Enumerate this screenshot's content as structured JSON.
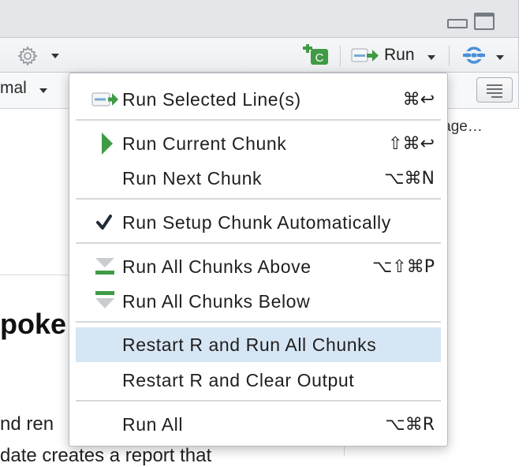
{
  "toolbar": {
    "run_label": "Run",
    "insert_chunk_letter": "C"
  },
  "format_menu": {
    "label": "mal"
  },
  "background_doc": {
    "language_fragment": "guage…",
    "heading_fragment": "poke",
    "paragraph_line1": "nd ren",
    "paragraph_line2": "date creates a report that"
  },
  "run_menu": {
    "items": [
      {
        "label": "Run Selected Line(s)",
        "shortcut": "⌘↩",
        "icon": "run-line-icon"
      },
      {
        "label": "Run Current Chunk",
        "shortcut": "⇧⌘↩",
        "icon": "play-icon"
      },
      {
        "label": "Run Next Chunk",
        "shortcut": "⌥⌘N",
        "icon": ""
      },
      {
        "label": "Run Setup Chunk Automatically",
        "shortcut": "",
        "icon": "checkmark-icon"
      },
      {
        "label": "Run All Chunks Above",
        "shortcut": "⌥⇧⌘P",
        "icon": "run-above-icon"
      },
      {
        "label": "Run All Chunks Below",
        "shortcut": "",
        "icon": "run-below-icon"
      },
      {
        "label": "Restart R and Run All Chunks",
        "shortcut": "",
        "icon": ""
      },
      {
        "label": "Restart R and Clear Output",
        "shortcut": "",
        "icon": ""
      },
      {
        "label": "Run All",
        "shortcut": "⌥⌘R",
        "icon": ""
      }
    ],
    "highlighted_item": "Restart R and Run All Chunks"
  },
  "colors": {
    "accent_green": "#3f9b45",
    "accent_blue": "#4a90d9",
    "highlight": "#d7e6f5"
  }
}
